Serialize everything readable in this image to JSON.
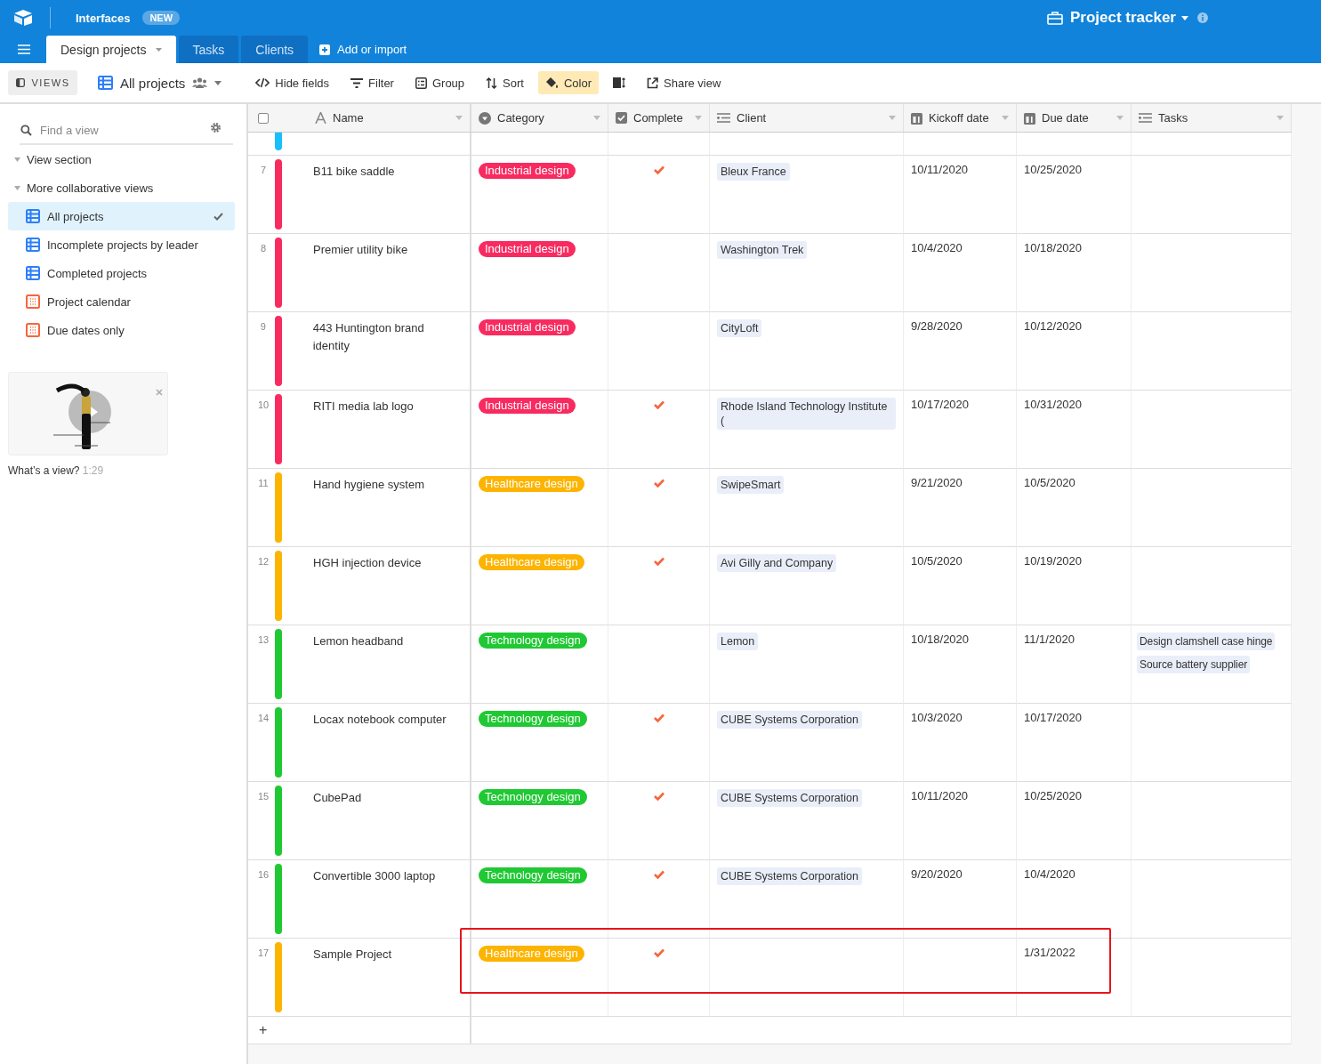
{
  "top_bar": {
    "product": "Interfaces",
    "badge": "NEW",
    "base_title": "Project tracker"
  },
  "tabs": [
    {
      "label": "Design projects",
      "selected": true
    },
    {
      "label": "Tasks",
      "selected": false
    },
    {
      "label": "Clients",
      "selected": false
    }
  ],
  "add_tab": "Add or import",
  "toolbar": {
    "views_button": "VIEWS",
    "view_name": "All projects",
    "buttons": [
      {
        "kind": "hide",
        "label": "Hide fields",
        "active": false
      },
      {
        "kind": "filter",
        "label": "Filter",
        "active": false
      },
      {
        "kind": "group",
        "label": "Group",
        "active": false
      },
      {
        "kind": "sort",
        "label": "Sort",
        "active": false
      },
      {
        "kind": "color",
        "label": "Color",
        "active": true
      },
      {
        "kind": "height",
        "active": false
      },
      {
        "kind": "share",
        "label": "Share view",
        "active": false
      }
    ]
  },
  "sidebar": {
    "search": {
      "placeholder": "Find a view"
    },
    "sections": [
      {
        "label": "View section",
        "expanded": true
      },
      {
        "label": "More collaborative views",
        "expanded": true,
        "items": [
          {
            "kind": "grid",
            "label": "All projects",
            "selected": true
          },
          {
            "kind": "grid",
            "label": "Incomplete projects by leader",
            "selected": false
          },
          {
            "kind": "grid",
            "label": "Completed projects",
            "selected": false
          },
          {
            "kind": "calendar",
            "label": "Project calendar",
            "selected": false
          },
          {
            "kind": "calendar",
            "label": "Due dates only",
            "selected": false
          }
        ]
      }
    ],
    "video": {
      "title": "What’s a view?",
      "duration": "1:29"
    }
  },
  "table": {
    "columns": [
      {
        "kind": "text",
        "label": "Name"
      },
      {
        "kind": "select",
        "label": "Category"
      },
      {
        "kind": "checkbox",
        "label": "Complete"
      },
      {
        "kind": "link",
        "label": "Client"
      },
      {
        "kind": "date",
        "label": "Kickoff date"
      },
      {
        "kind": "date",
        "label": "Due date"
      },
      {
        "kind": "link",
        "label": "Tasks"
      }
    ],
    "select_all": {
      "checked": false
    },
    "row_above": {
      "color": "#18bfff"
    },
    "rows": [
      {
        "number": "7",
        "name": "B11 bike saddle",
        "category": {
          "label": "Industrial design",
          "color": "#f82b60"
        },
        "complete": true,
        "client": "Bleux France",
        "kickoff": "10/11/2020",
        "due": "10/25/2020",
        "tasks": [],
        "highlighted": false
      },
      {
        "number": "8",
        "name": "Premier utility bike",
        "category": {
          "label": "Industrial design",
          "color": "#f82b60"
        },
        "complete": false,
        "client": "Washington Trek",
        "kickoff": "10/4/2020",
        "due": "10/18/2020",
        "tasks": [],
        "highlighted": false
      },
      {
        "number": "9",
        "name": "443 Huntington brand identity",
        "category": {
          "label": "Industrial design",
          "color": "#f82b60"
        },
        "complete": false,
        "client": "CityLoft",
        "kickoff": "9/28/2020",
        "due": "10/12/2020",
        "tasks": [],
        "highlighted": false
      },
      {
        "number": "10",
        "name": "RITI media lab logo",
        "category": {
          "label": "Industrial design",
          "color": "#f82b60"
        },
        "complete": true,
        "client": "Rhode Island Technology Institute (",
        "kickoff": "10/17/2020",
        "due": "10/31/2020",
        "tasks": [],
        "highlighted": false
      },
      {
        "number": "11",
        "name": "Hand hygiene system",
        "category": {
          "label": "Healthcare design",
          "color": "#fcb400"
        },
        "complete": true,
        "client": "SwipeSmart",
        "kickoff": "9/21/2020",
        "due": "10/5/2020",
        "tasks": [],
        "highlighted": false
      },
      {
        "number": "12",
        "name": "HGH injection device",
        "category": {
          "label": "Healthcare design",
          "color": "#fcb400"
        },
        "complete": true,
        "client": "Avi Gilly and Company",
        "kickoff": "10/5/2020",
        "due": "10/19/2020",
        "tasks": [],
        "highlighted": false
      },
      {
        "number": "13",
        "name": "Lemon headband",
        "category": {
          "label": "Technology design",
          "color": "#20c933"
        },
        "complete": false,
        "client": "Lemon",
        "kickoff": "10/18/2020",
        "due": "11/1/2020",
        "tasks": [
          "Design clamshell case hinge",
          "Source battery supplier"
        ],
        "highlighted": false
      },
      {
        "number": "14",
        "name": "Locax notebook computer",
        "category": {
          "label": "Technology design",
          "color": "#20c933"
        },
        "complete": true,
        "client": "CUBE Systems Corporation",
        "kickoff": "10/3/2020",
        "due": "10/17/2020",
        "tasks": [],
        "highlighted": false
      },
      {
        "number": "15",
        "name": "CubePad",
        "category": {
          "label": "Technology design",
          "color": "#20c933"
        },
        "complete": true,
        "client": "CUBE Systems Corporation",
        "kickoff": "10/11/2020",
        "due": "10/25/2020",
        "tasks": [],
        "highlighted": false
      },
      {
        "number": "16",
        "name": "Convertible 3000 laptop",
        "category": {
          "label": "Technology design",
          "color": "#20c933"
        },
        "complete": true,
        "client": "CUBE Systems Corporation",
        "kickoff": "9/20/2020",
        "due": "10/4/2020",
        "tasks": [],
        "highlighted": false
      },
      {
        "number": "17",
        "name": "Sample Project",
        "category": {
          "label": "Healthcare design",
          "color": "#fcb400"
        },
        "complete": true,
        "client": "",
        "kickoff": "",
        "due": "1/31/2022",
        "tasks": [],
        "highlighted": true
      }
    ],
    "add_row": "+"
  }
}
